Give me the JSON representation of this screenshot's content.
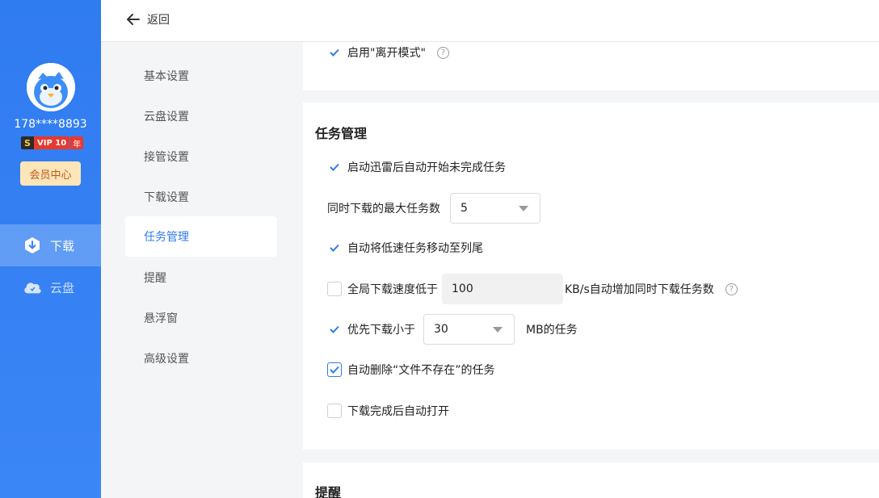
{
  "user": {
    "phone": "178****8893",
    "vip_badge_s": "S",
    "vip_level": "VIP 10",
    "vip_year": "年",
    "member_center": "会员中心"
  },
  "nav": [
    {
      "label": "下载",
      "icon": "download-shield-icon",
      "active": true
    },
    {
      "label": "云盘",
      "icon": "cloud-icon",
      "active": false
    }
  ],
  "header": {
    "back_label": "返回"
  },
  "settings_menu": [
    "基本设置",
    "云盘设置",
    "接管设置",
    "下载设置",
    "任务管理",
    "提醒",
    "悬浮窗",
    "高级设置"
  ],
  "settings_menu_active": "任务管理",
  "top_card": {
    "away_mode_label": "启用\"离开模式\"",
    "away_mode_checked": true
  },
  "task_management": {
    "title": "任务管理",
    "auto_start_label": "启动迅雷后自动开始未完成任务",
    "max_tasks_label": "同时下载的最大任务数",
    "max_tasks_value": "5",
    "move_slow_label": "自动将低速任务移动至列尾",
    "global_speed_label": "全局下载速度低于",
    "global_speed_value": "100",
    "global_speed_suffix": "KB/s自动增加同时下载任务数",
    "prioritize_label": "优先下载小于",
    "prioritize_value": "30",
    "prioritize_suffix": "MB的任务",
    "auto_delete_label": "自动删除“文件不存在”的任务",
    "auto_open_label": "下载完成后自动打开"
  },
  "reminder": {
    "title": "提醒"
  },
  "help_glyph": "?",
  "colors": {
    "accent": "#2f7bf0",
    "sidebar": "#3b86f6",
    "vip_red": "#e8392c"
  }
}
